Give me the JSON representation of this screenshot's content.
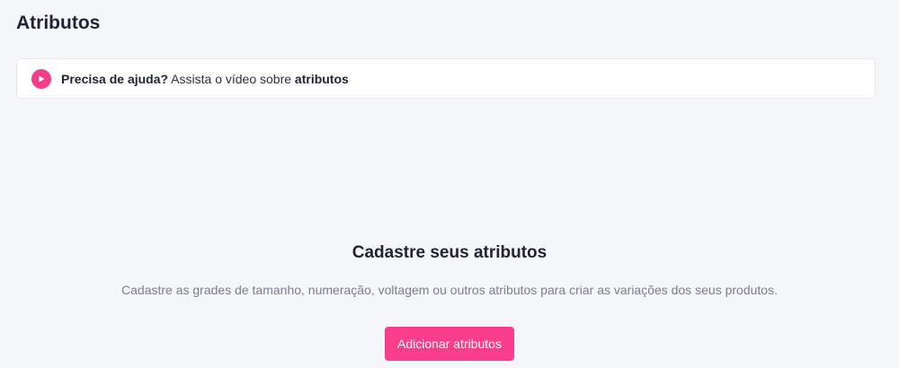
{
  "header": {
    "title": "Atributos"
  },
  "help": {
    "icon": "play-icon",
    "bold_prefix": "Precisa de ajuda?",
    "text": " Assista o vídeo sobre ",
    "bold_suffix": "atributos"
  },
  "empty_state": {
    "title": "Cadastre seus atributos",
    "description": "Cadastre as grades de tamanho, numeração, voltagem ou outros atributos para criar as variações dos seus produtos.",
    "button_label": "Adicionar atributos"
  },
  "colors": {
    "accent": "#f83e8b",
    "background": "#f5f6fa"
  }
}
